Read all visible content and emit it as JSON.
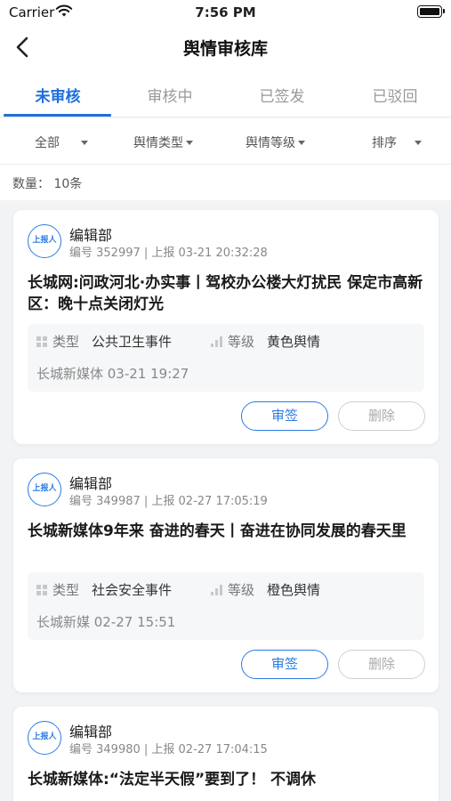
{
  "status_bar": {
    "carrier": "Carrier",
    "time": "7:56 PM"
  },
  "nav": {
    "title": "舆情审核库"
  },
  "tabs": [
    {
      "label": "未审核",
      "active": true
    },
    {
      "label": "审核中",
      "active": false
    },
    {
      "label": "已签发",
      "active": false
    },
    {
      "label": "已驳回",
      "active": false
    }
  ],
  "filters": [
    {
      "label": "全部"
    },
    {
      "label": "舆情类型"
    },
    {
      "label": "舆情等级"
    },
    {
      "label": "排序"
    }
  ],
  "count": {
    "label": "数量：",
    "value": "10条"
  },
  "labels": {
    "badge": "上报人",
    "type": "类型",
    "level": "等级",
    "approve": "审签",
    "delete": "删除"
  },
  "colors": {
    "accent": "#1e6fd9",
    "background": "#f2f3f5"
  },
  "cards": [
    {
      "dept": "编辑部",
      "meta": "编号 352997 | 上报 03-21 20:32:28",
      "headline": "长城网:问政河北·办实事丨驾校办公楼大灯扰民 保定市高新区：晚十点关闭灯光",
      "type": "公共卫生事件",
      "level": "黄色舆情",
      "source_time": "长城新媒体   03-21 19:27"
    },
    {
      "dept": "编辑部",
      "meta": "编号 349987 | 上报 02-27 17:05:19",
      "headline": "长城新媒体9年来 奋进的春天丨奋进在协同发展的春天里",
      "type": "社会安全事件",
      "level": "橙色舆情",
      "source_time": "长城新媒   02-27 15:51"
    },
    {
      "dept": "编辑部",
      "meta": "编号 349980 | 上报 02-27 17:04:15",
      "headline": "长城新媒体:“法定半天假”要到了！ 不调休",
      "type": "",
      "level": "",
      "source_time": ""
    }
  ]
}
